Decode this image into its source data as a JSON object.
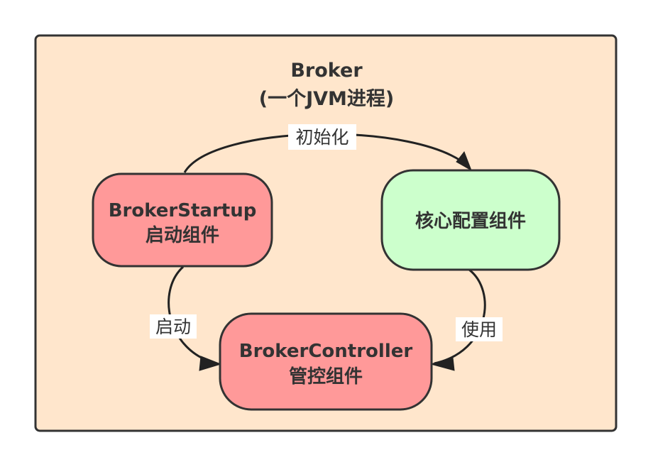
{
  "container": {
    "title_line1": "Broker",
    "title_line2": "(一个JVM进程)",
    "fill_color": "#ffe6cc"
  },
  "nodes": {
    "startup": {
      "line1": "BrokerStartup",
      "line2": "启动组件",
      "fill_color": "#ff9999"
    },
    "config": {
      "line1": "核心配置组件",
      "fill_color": "#ccffcc"
    },
    "controller": {
      "line1": "BrokerController",
      "line2": "管控组件",
      "fill_color": "#ff9999"
    }
  },
  "edges": {
    "init_label": "初始化",
    "start_label": "启动",
    "use_label": "使用"
  }
}
